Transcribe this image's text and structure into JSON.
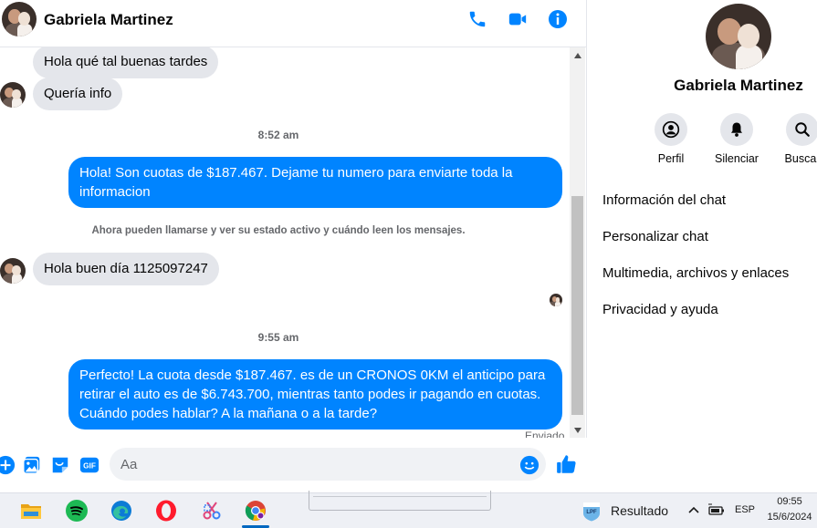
{
  "header": {
    "contact_name": "Gabriela Martinez",
    "icons": [
      "phone-icon",
      "video-camera-icon",
      "info-icon"
    ],
    "accent_color": "#0084ff"
  },
  "messages": {
    "incoming_1": "Hola qué tal buenas tardes",
    "incoming_2": "Quería info",
    "time_1": "8:52 am",
    "outgoing_1": "Hola! Son cuotas de $187.467. Dejame tu numero para enviarte toda la informacion",
    "system_notice": "Ahora pueden llamarse y ver su estado activo y cuándo leen los mensajes.",
    "incoming_3": "Hola buen día 1125097247",
    "time_2": "9:55 am",
    "outgoing_2": "Perfecto! La cuota desde $187.467. es de un CRONOS 0KM el anticipo para retirar el auto es de $6.743.700, mientras tanto podes ir pagando en cuotas. Cuándo podes hablar? A la mañana o a la tarde?",
    "status": "Enviado"
  },
  "composer": {
    "placeholder": "Aa",
    "icons": [
      "plus-circle-icon",
      "image-icon",
      "sticker-icon",
      "gif-icon",
      "emoji-icon",
      "thumbs-up-icon"
    ]
  },
  "panel": {
    "contact_name": "Gabriela Martinez",
    "actions": [
      {
        "label": "Perfil",
        "icon": "profile-icon"
      },
      {
        "label": "Silenciar",
        "icon": "bell-icon"
      },
      {
        "label": "Buscar",
        "icon": "search-icon"
      }
    ],
    "menu": [
      "Información del chat",
      "Personalizar chat",
      "Multimedia, archivos y enlaces",
      "Privacidad y ayuda"
    ]
  },
  "taskbar": {
    "apps": [
      "file-explorer-icon",
      "spotify-icon",
      "edge-icon",
      "opera-icon",
      "snipping-tool-icon",
      "chrome-icon"
    ],
    "weather_text": "Resultado",
    "language": "ESP",
    "time": "09:55",
    "date": "15/6/2024"
  }
}
